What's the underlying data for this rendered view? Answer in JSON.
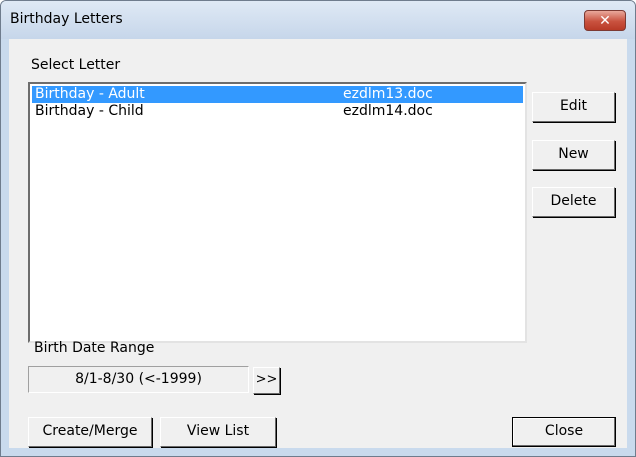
{
  "window": {
    "title": "Birthday Letters",
    "close_glyph": "✕"
  },
  "letters": {
    "label": "Select Letter",
    "rows": [
      {
        "name": "Birthday - Adult",
        "file": "ezdlm13.doc",
        "selected": true
      },
      {
        "name": "Birthday - Child",
        "file": "ezdlm14.doc",
        "selected": false
      }
    ]
  },
  "side_buttons": {
    "edit": "Edit",
    "new": "New",
    "delete": "Delete"
  },
  "range": {
    "label": "Birth Date Range",
    "value": "8/1-8/30 (<-1999)",
    "next_label": ">>"
  },
  "bottom_buttons": {
    "create_merge": "Create/Merge",
    "view_list": "View List",
    "close": "Close"
  },
  "colors": {
    "selection": "#3399ff",
    "titlebar": "#c9daed",
    "close_button": "#c9523f"
  }
}
